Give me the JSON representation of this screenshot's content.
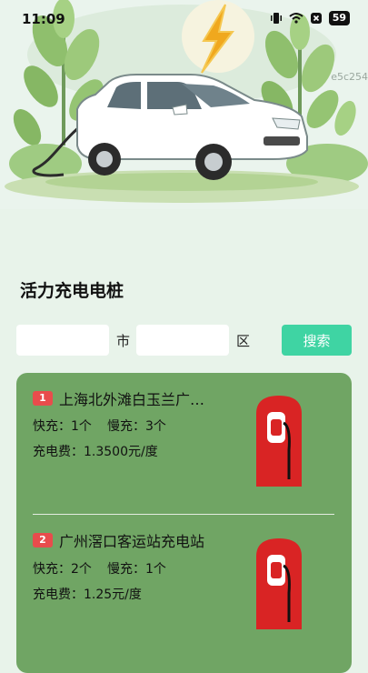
{
  "status_bar": {
    "time": "11:09",
    "battery": "59",
    "icons": [
      "vibrate-icon",
      "wifi-icon",
      "sim-off-icon",
      "battery-icon"
    ]
  },
  "hero": {
    "watermark": "e5c254",
    "car_color": "#ffffff",
    "bolt_color": "#f0a81e"
  },
  "page_title": "活力充电电桩",
  "search": {
    "city_value": "",
    "city_unit": "市",
    "district_value": "",
    "district_unit": "区",
    "button_label": "搜索",
    "button_color": "#3fd4a3"
  },
  "stations": [
    {
      "index": "1",
      "name": "上海北外滩白玉兰广…",
      "fast_label": "快充：1个",
      "slow_label": "慢充：3个",
      "fee_label": "充电费：1.3500元/度"
    },
    {
      "index": "2",
      "name": "广州滘口客运站充电站",
      "fast_label": "快充：2个",
      "slow_label": "慢充：1个",
      "fee_label": "充电费：1.25元/度"
    }
  ],
  "colors": {
    "panel": "#70a564",
    "badge": "#e84c4c",
    "charger": "#d92424"
  }
}
